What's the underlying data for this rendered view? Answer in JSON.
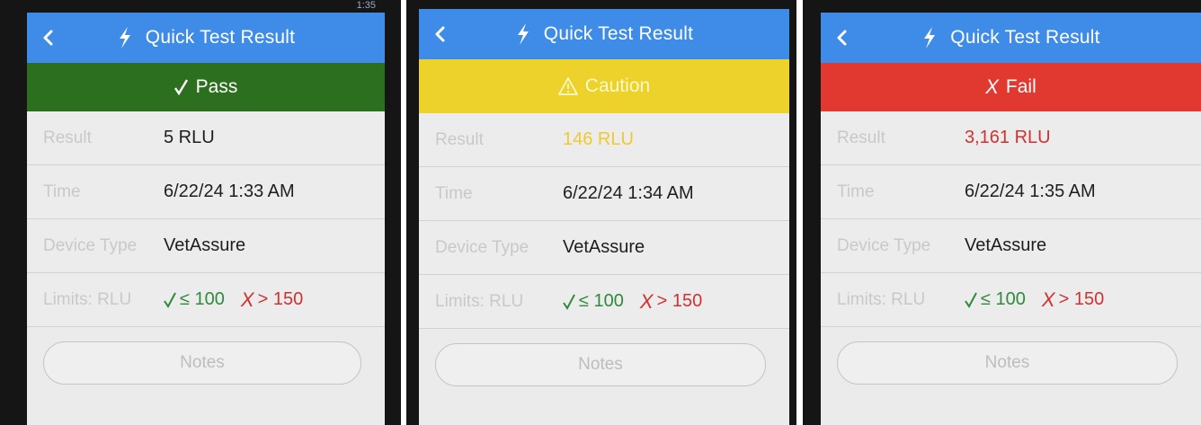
{
  "status_time": "1:35",
  "panels": [
    {
      "title": "Quick Test Result",
      "banner": {
        "status": "pass",
        "icon": "check-icon",
        "text": "Pass",
        "color": "#2c6f1e"
      },
      "rows": {
        "result_label": "Result",
        "result_value": "5 RLU",
        "time_label": "Time",
        "time_value": "6/22/24 1:33 AM",
        "device_label": "Device Type",
        "device_value": "VetAssure",
        "limits_label": "Limits: RLU",
        "limit_pass": "≤ 100",
        "limit_fail": "> 150"
      },
      "notes_label": "Notes"
    },
    {
      "title": "Quick Test Result",
      "banner": {
        "status": "caution",
        "icon": "warning-icon",
        "text": "Caution",
        "color": "#ecd22b"
      },
      "rows": {
        "result_label": "Result",
        "result_value": "146 RLU",
        "time_label": "Time",
        "time_value": "6/22/24 1:34 AM",
        "device_label": "Device Type",
        "device_value": "VetAssure",
        "limits_label": "Limits: RLU",
        "limit_pass": "≤ 100",
        "limit_fail": "> 150"
      },
      "notes_label": "Notes"
    },
    {
      "title": "Quick Test Result",
      "banner": {
        "status": "fail",
        "icon": "x-icon",
        "text": "Fail",
        "color": "#e1382f"
      },
      "rows": {
        "result_label": "Result",
        "result_value": "3,161 RLU",
        "time_label": "Time",
        "time_value": "6/22/24 1:35 AM",
        "device_label": "Device Type",
        "device_value": "VetAssure",
        "limits_label": "Limits: RLU",
        "limit_pass": "≤ 100",
        "limit_fail": "> 150"
      },
      "notes_label": "Notes"
    }
  ],
  "colors": {
    "header": "#3f8ce8",
    "pass": "#2f8a3c",
    "fail": "#d23131",
    "caution_text": "#f0c92e"
  }
}
